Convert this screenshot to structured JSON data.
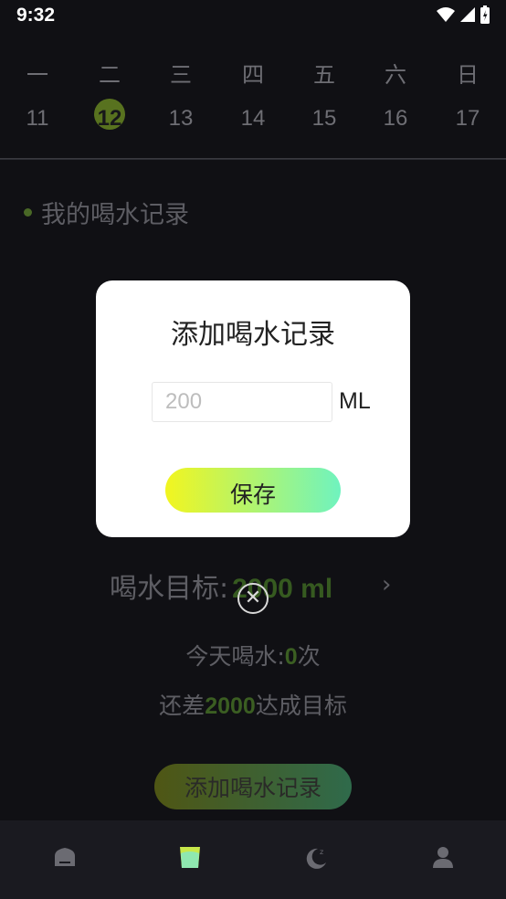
{
  "status": {
    "time": "9:32"
  },
  "calendar": {
    "weekdays": [
      "一",
      "二",
      "三",
      "四",
      "五",
      "六",
      "日"
    ],
    "days": [
      "11",
      "12",
      "13",
      "14",
      "15",
      "16",
      "17"
    ],
    "selected_day": "12"
  },
  "main": {
    "section_title": "我的喝水记录",
    "goal_label": "喝水目标:",
    "goal_value": "2000 ml",
    "today_prefix": "今天喝水:",
    "today_count": "0",
    "today_suffix": "次",
    "remain_prefix": "还差",
    "remain_value": "2000",
    "remain_suffix": "达成目标",
    "add_button": "添加喝水记录"
  },
  "dialog": {
    "title": "添加喝水记录",
    "input_placeholder": "200",
    "unit": "ML",
    "save_button": "保存"
  },
  "tabs": [
    {
      "icon": "home-icon"
    },
    {
      "icon": "cup-icon",
      "active": true
    },
    {
      "icon": "moon-sleep-icon"
    },
    {
      "icon": "user-icon"
    }
  ],
  "colors": {
    "accent_green": "#365a20",
    "gradient_start": "#f2f51f",
    "gradient_end": "#6ff3bf",
    "tab_active": "#c8e84a"
  }
}
